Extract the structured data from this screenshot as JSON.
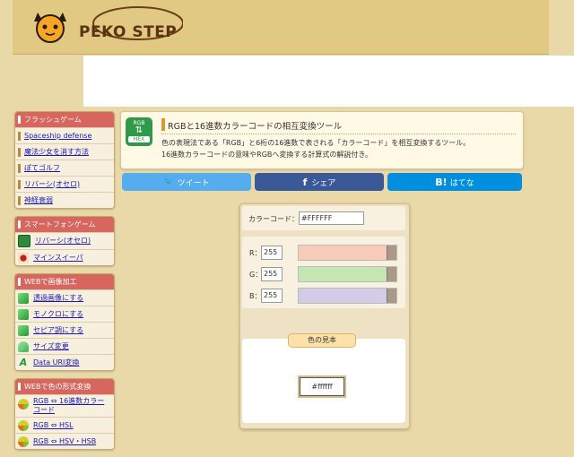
{
  "header": {
    "logo_text": "PEKO STEP"
  },
  "sidebar": [
    {
      "heading": "フラッシュゲーム",
      "items": [
        {
          "label": "Spaceship defense",
          "icon": "bar"
        },
        {
          "label": "魔法少女を消す方法",
          "icon": "bar"
        },
        {
          "label": "ぽてゴルフ",
          "icon": "bar"
        },
        {
          "label": "リバーシ(オセロ)",
          "icon": "bar"
        },
        {
          "label": "神経衰弱",
          "icon": "bar"
        }
      ]
    },
    {
      "heading": "スマートフォンゲーム",
      "items": [
        {
          "label": "リバーシ(オセロ)",
          "icon": "reversi-icon"
        },
        {
          "label": "マインスイーパ",
          "icon": "mine-icon"
        }
      ]
    },
    {
      "heading": "WEBで画像加工",
      "items": [
        {
          "label": "透過画像にする",
          "icon": "green-cube-icon"
        },
        {
          "label": "モノクロにする",
          "icon": "green-cube-icon"
        },
        {
          "label": "セピア調にする",
          "icon": "green-cube-icon"
        },
        {
          "label": "サイズ変更",
          "icon": "green-cube-icon"
        },
        {
          "label": "Data URI変換",
          "icon": "letter-a-icon"
        }
      ]
    },
    {
      "heading": "WEBで色の形式変換",
      "items": [
        {
          "label": "RGB ⇔ 16進数カラーコード",
          "icon": "color-dot-icon"
        },
        {
          "label": "RGB ⇔ HSL",
          "icon": "color-dot-icon"
        },
        {
          "label": "RGB ⇔ HSV・HSB",
          "icon": "color-dot-icon"
        }
      ]
    }
  ],
  "main": {
    "icon_top": "RGB",
    "icon_bottom": "HEX",
    "title": "RGBと16進数カラーコードの相互変換ツール",
    "desc_line1": "色の表現法である「RGB」と6桁の16進数で表される「カラーコード」を相互変換するツール。",
    "desc_line2": "16進数カラーコードの意味やRGBへ変換する計算式の解説付き。"
  },
  "share": {
    "tweet": "ツイート",
    "tweet_color": "#55acee",
    "facebook": "シェア",
    "facebook_color": "#3b5998",
    "hatena": "はてな",
    "hatena_color": "#008fde"
  },
  "tool": {
    "colorcode_label": "カラーコード：",
    "colorcode_value": "#FFFFFF",
    "r_label": "R：",
    "r_value": "255",
    "r_track": "#f6ccb9",
    "g_label": "G：",
    "g_value": "255",
    "g_track": "#c6e6b1",
    "b_label": "B：",
    "b_value": "255",
    "b_track": "#d2cce6",
    "sample_label": "色の見本",
    "sample_value": "#ffffff"
  }
}
